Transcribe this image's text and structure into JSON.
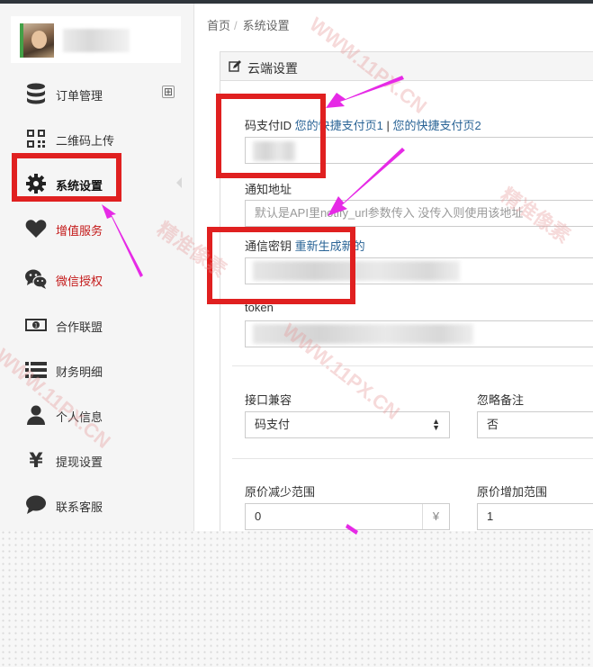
{
  "sidebar": {
    "items": [
      {
        "label": "订单管理",
        "icon": "database-icon"
      },
      {
        "label": "二维码上传",
        "icon": "qrcode-icon"
      },
      {
        "label": "系统设置",
        "icon": "gear-icon"
      },
      {
        "label": "增值服务",
        "icon": "heart-icon"
      },
      {
        "label": "微信授权",
        "icon": "wechat-icon"
      },
      {
        "label": "合作联盟",
        "icon": "money-icon"
      },
      {
        "label": "财务明细",
        "icon": "list-icon"
      },
      {
        "label": "个人信息",
        "icon": "user-icon"
      },
      {
        "label": "提现设置",
        "icon": "yen-icon"
      },
      {
        "label": "联系客服",
        "icon": "comment-icon"
      }
    ],
    "expand_symbol": "⊞"
  },
  "breadcrumb": {
    "home": "首页",
    "separator": "/",
    "current": "系统设置"
  },
  "panel": {
    "title": "云端设置",
    "pay_id": {
      "label": "码支付ID",
      "link1": "您的快捷支付页1",
      "divider": "|",
      "link2": "您的快捷支付页2"
    },
    "notify": {
      "label": "通知地址",
      "placeholder": "默认是API里notify_url参数传入 没传入则使用该地址"
    },
    "secret": {
      "label": "通信密钥",
      "link": "重新生成新的"
    },
    "token": {
      "label": "token"
    },
    "compat": {
      "label": "接口兼容",
      "value": "码支付"
    },
    "ignore_note": {
      "label": "忽略备注",
      "value": "否"
    },
    "decrease": {
      "label": "原价减少范围",
      "value": "0",
      "addon": "¥"
    },
    "increase": {
      "label": "原价增加范围",
      "value": "1"
    }
  },
  "watermark": {
    "text1": "精准像素",
    "text2": "WWW.11PX.CN"
  },
  "colors": {
    "accent_red": "#e02020",
    "arrow_magenta": "#e62ae6",
    "link_blue": "#2a6496",
    "danger_red": "#c41a1a"
  }
}
